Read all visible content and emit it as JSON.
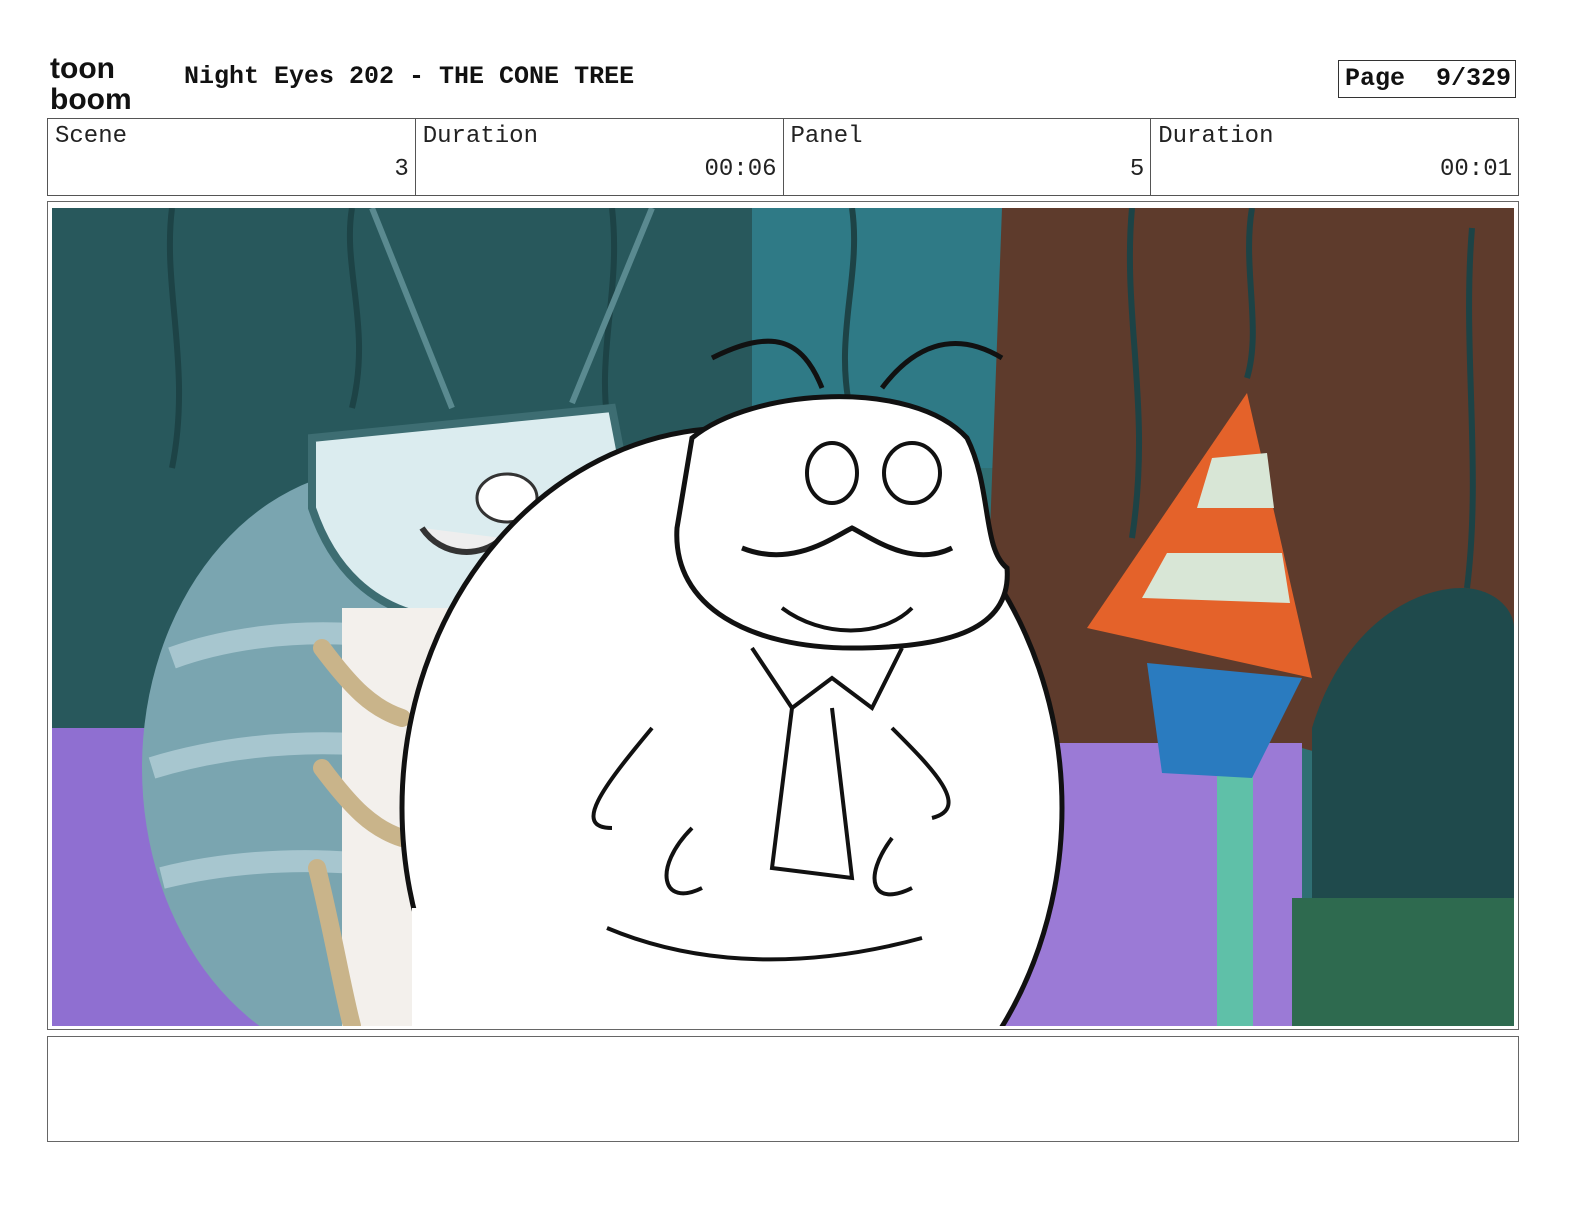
{
  "header": {
    "logo": {
      "line1": "toon",
      "line2": "boom",
      "icon": "toon-boom-logo"
    },
    "title": "Night Eyes 202 - THE CONE TREE",
    "page_label": "Page",
    "page_value": "9/329"
  },
  "info": {
    "scene_label": "Scene",
    "scene_value": "3",
    "scene_duration_label": "Duration",
    "scene_duration_value": "00:06",
    "panel_label": "Panel",
    "panel_value": "5",
    "panel_duration_label": "Duration",
    "panel_duration_value": "00:01"
  },
  "panel": {
    "image": "storyboard-panel-image",
    "colors": {
      "sky": "#2f6f73",
      "tree_brown": "#5e3b2c",
      "purple_ground": "#8f6fd1",
      "cone_orange": "#e4622a",
      "cone_stripe": "#d8e6d6",
      "bug_blue": "#7aa5b0"
    }
  },
  "notes": {
    "text": ""
  }
}
